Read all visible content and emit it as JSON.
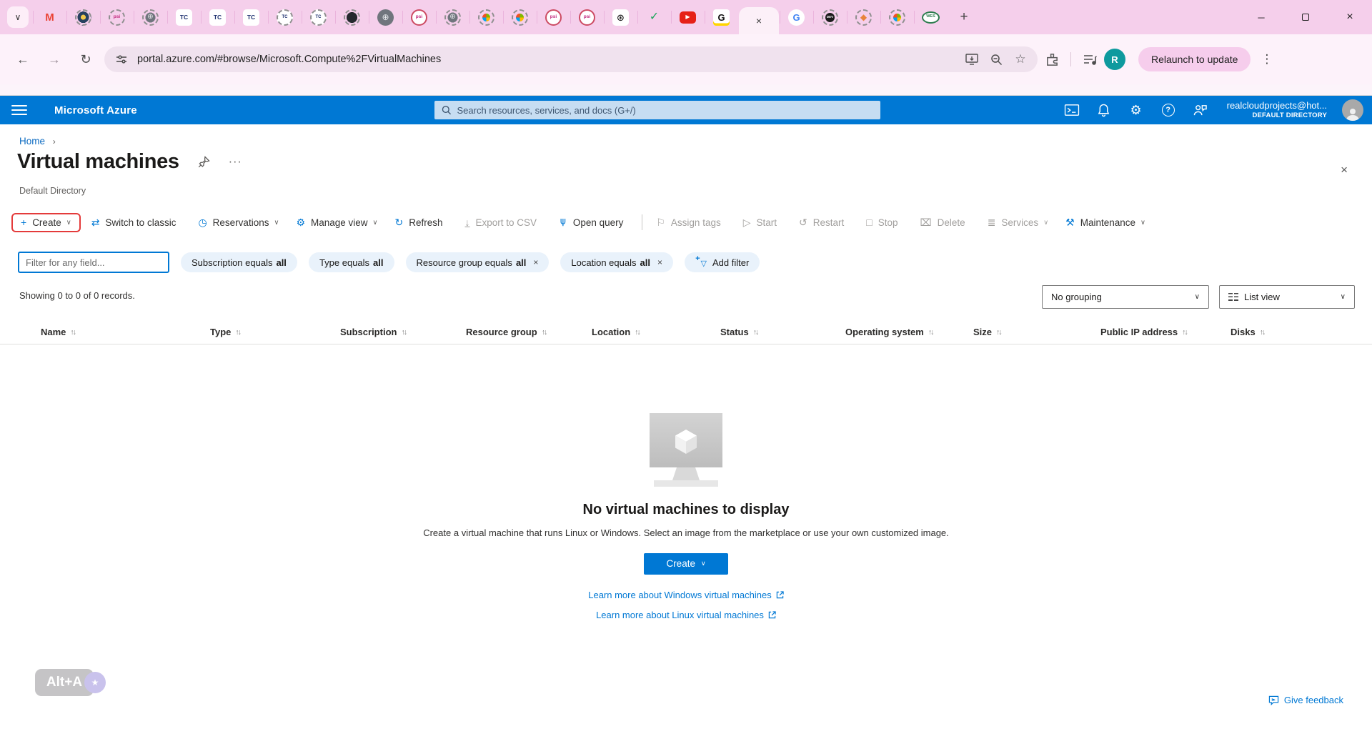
{
  "colors": {
    "azure_blue": "#0078d4",
    "chrome_theme_pink": "#f5cfeb",
    "highlight_red": "#e43b3b",
    "link_blue": "#0b6ac1",
    "avatar_teal": "#0e9a9e",
    "search_fill": "#c6ddf2"
  },
  "browser": {
    "tab_caret_glyph": "∨",
    "tabs_before": [
      {
        "k": "gmail",
        "g": "M"
      },
      {
        "k": "shield",
        "g": ""
      },
      {
        "k": "psid",
        "g": "psi"
      },
      {
        "k": "globed",
        "g": "⊕"
      },
      {
        "k": "tc",
        "g": "TC"
      },
      {
        "k": "tc",
        "g": "TC"
      },
      {
        "k": "tc",
        "g": "TC"
      },
      {
        "k": "tcd",
        "g": "TC"
      },
      {
        "k": "tcd",
        "g": "TC"
      },
      {
        "k": "ghd",
        "g": ""
      },
      {
        "k": "globe",
        "g": "⊕"
      },
      {
        "k": "psi",
        "g": "psi"
      },
      {
        "k": "globed",
        "g": "⊕"
      },
      {
        "k": "msd",
        "g": ""
      },
      {
        "k": "msd",
        "g": ""
      },
      {
        "k": "psi",
        "g": "psi"
      },
      {
        "k": "psi",
        "g": "psi"
      },
      {
        "k": "gpt",
        "g": "⊛"
      },
      {
        "k": "check",
        "g": "✓"
      },
      {
        "k": "yt",
        "g": "▶"
      },
      {
        "k": "gnews",
        "g": "G"
      }
    ],
    "active_tab_close": "×",
    "tabs_after": [
      {
        "k": "google",
        "g": "G"
      },
      {
        "k": "devd",
        "g": "DEV"
      },
      {
        "k": "cubed",
        "g": "◆"
      },
      {
        "k": "msd",
        "g": ""
      },
      {
        "k": "wes",
        "g": "WES"
      }
    ],
    "new_tab_glyph": "+",
    "window_controls": {
      "minimize": "─",
      "close": "×"
    },
    "back_glyph": "←",
    "forward_glyph": "→",
    "reload_glyph": "↻",
    "url": "portal.azure.com/#browse/Microsoft.Compute%2FVirtualMachines",
    "star_glyph": "☆",
    "avatar_letter": "R",
    "relaunch_label": "Relaunch to update",
    "kebab_glyph": "⋮"
  },
  "azure_header": {
    "brand": "Microsoft Azure",
    "search_placeholder": "Search resources, services, and docs (G+/)",
    "gear_glyph": "⚙",
    "help_glyph": "?",
    "account_email": "realcloudprojects@hot...",
    "account_directory": "DEFAULT DIRECTORY"
  },
  "page": {
    "breadcrumb_home": "Home",
    "breadcrumb_sep": "›",
    "title": "Virtual machines",
    "ellipsis_glyph": "···",
    "close_glyph": "×",
    "subtitle": "Default Directory",
    "toolbar": [
      {
        "g": "+",
        "label": "Create",
        "caret": "∨",
        "state": "on",
        "cls": "boxed"
      },
      {
        "g": "⇄",
        "label": "Switch to classic",
        "state": "on"
      },
      {
        "g": "◷",
        "label": "Reservations",
        "caret": "∨",
        "state": "on"
      },
      {
        "g": "⚙",
        "label": "Manage view",
        "caret": "∨",
        "state": "on"
      },
      {
        "g": "↻",
        "label": "Refresh",
        "state": "on"
      },
      {
        "g": "↓",
        "label": "Export to CSV",
        "state": "off",
        "icls": "exp"
      },
      {
        "g": "⋔",
        "label": "Open query",
        "state": "on",
        "icls": "rot"
      },
      {
        "g": "",
        "label": "",
        "cls": "divider"
      },
      {
        "g": "⚐",
        "label": "Assign tags",
        "state": "off"
      },
      {
        "g": "▷",
        "label": "Start",
        "state": "off"
      },
      {
        "g": "↺",
        "label": "Restart",
        "state": "off"
      },
      {
        "g": "□",
        "label": "Stop",
        "state": "off"
      },
      {
        "g": "⌧",
        "label": "Delete",
        "state": "off"
      },
      {
        "g": "≣",
        "label": "Services",
        "caret": "∨",
        "state": "off"
      },
      {
        "g": "⚒",
        "label": "Maintenance",
        "caret": "∨",
        "state": "on"
      }
    ],
    "filter_placeholder": "Filter for any field...",
    "filters": [
      {
        "field": "Subscription equals",
        "value": "all",
        "close": ""
      },
      {
        "field": "Type equals",
        "value": "all",
        "close": ""
      },
      {
        "field": "Resource group equals",
        "value": "all",
        "close": "×"
      },
      {
        "field": "Location equals",
        "value": "all",
        "close": "×"
      }
    ],
    "add_filter": {
      "label": "Add filter",
      "plus": "+",
      "funnel": "▽"
    },
    "records_summary": "Showing 0 to 0 of 0 records.",
    "grouping_value": "No grouping",
    "view_value": "List view",
    "dropdown_caret": "∨",
    "columns": [
      {
        "label": "Name",
        "sort": "↑↓"
      },
      {
        "label": "Type",
        "sort": "↑↓"
      },
      {
        "label": "Subscription",
        "sort": "↑↓"
      },
      {
        "label": "Resource group",
        "sort": "↑↓"
      },
      {
        "label": "Location",
        "sort": "↑↓"
      },
      {
        "label": "Status",
        "sort": "↑↓"
      },
      {
        "label": "Operating system",
        "sort": "↑↓"
      },
      {
        "label": "Size",
        "sort": "↑↓"
      },
      {
        "label": "Public IP address",
        "sort": "↑↓"
      },
      {
        "label": "Disks",
        "sort": "↑↓"
      }
    ],
    "empty": {
      "title": "No virtual machines to display",
      "description": "Create a virtual machine that runs Linux or Windows. Select an image from the marketplace or use your own customized image.",
      "create_label": "Create",
      "create_caret": "∨",
      "links": [
        {
          "label": "Learn more about Windows virtual machines"
        },
        {
          "label": "Learn more about Linux virtual machines"
        }
      ]
    },
    "shortcut_badge": "Alt+A",
    "sparkle_glyph": "★",
    "feedback_label": "Give feedback"
  }
}
